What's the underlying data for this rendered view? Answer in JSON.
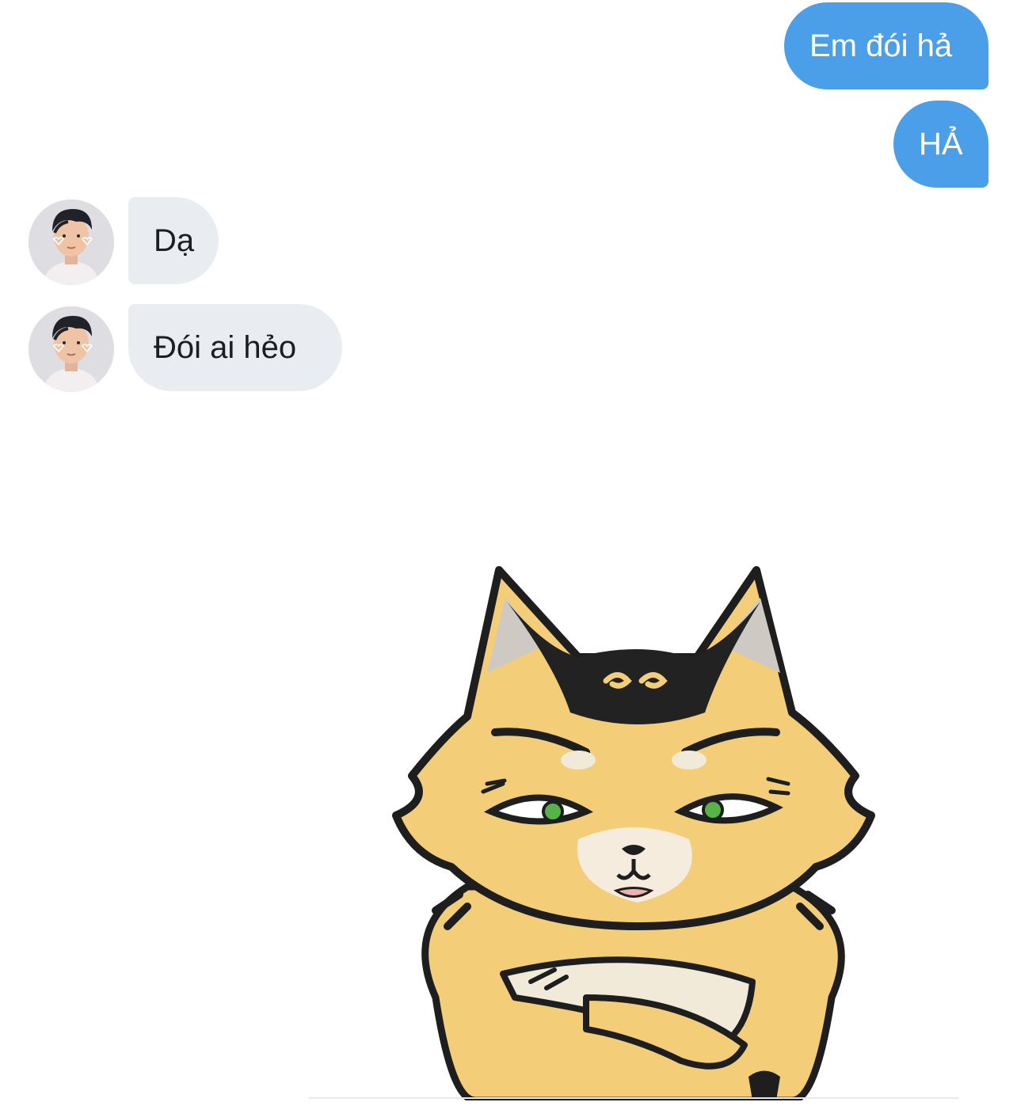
{
  "conversation": {
    "messages": [
      {
        "sender": "me",
        "text": "Em đói hả"
      },
      {
        "sender": "me",
        "text": "HẢ"
      },
      {
        "sender": "other",
        "text": "Dạ"
      },
      {
        "sender": "other",
        "text": "Đói ai hẻo"
      }
    ],
    "sticker": {
      "icon": "angry-yellow-cat-sticker"
    }
  },
  "colors": {
    "outgoing_bubble": "#4b9fe9",
    "incoming_bubble": "#e9edf1",
    "background": "#ffffff"
  }
}
